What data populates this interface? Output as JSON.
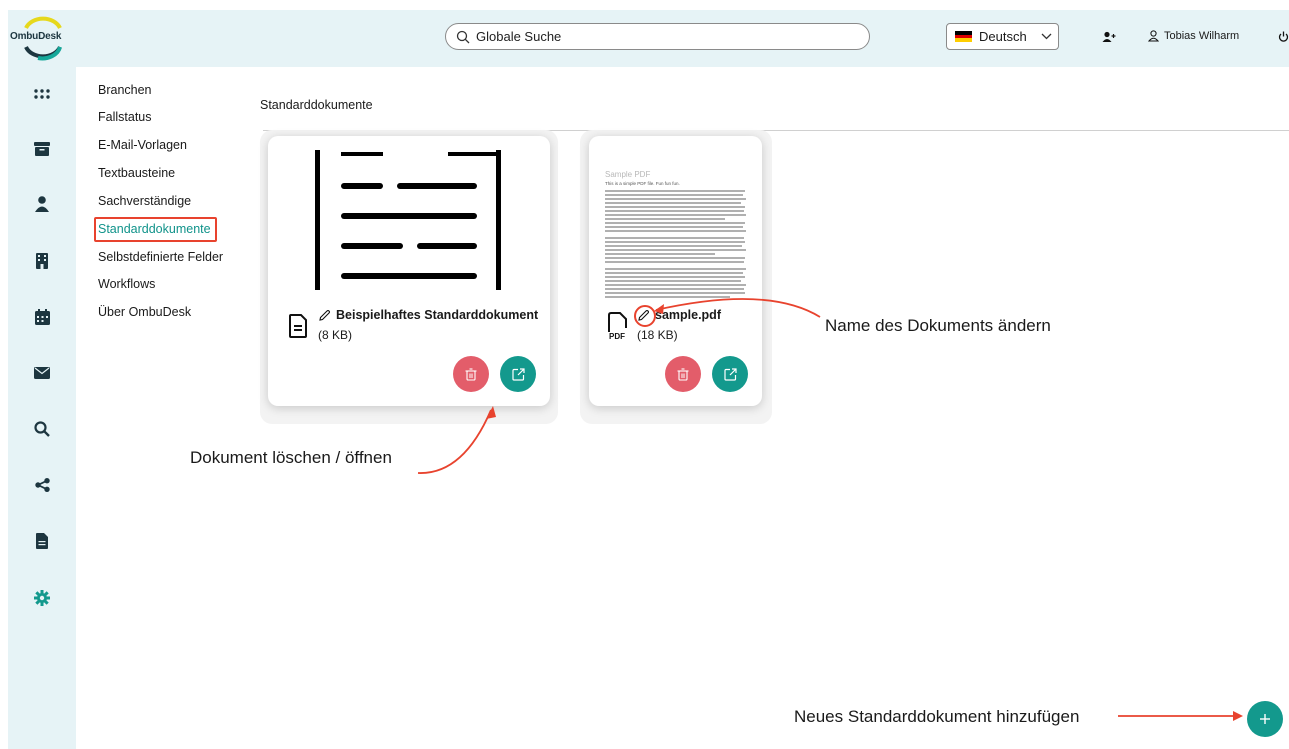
{
  "app": {
    "logo_text": "OmbuDesk"
  },
  "topbar": {
    "search_placeholder": "Globale Suche",
    "language": "Deutsch",
    "user_name": "Tobias Wilharm"
  },
  "rail": {
    "icons": [
      "apps-icon",
      "archive-icon",
      "person-icon",
      "building-icon",
      "calendar-icon",
      "mail-icon",
      "search-icon",
      "share-icon",
      "document-icon",
      "settings-icon"
    ]
  },
  "settings_menu": {
    "items": [
      "Branchen",
      "Fallstatus",
      "E-Mail-Vorlagen",
      "Textbausteine",
      "Sachverständige",
      "Standarddokumente",
      "Selbstdefinierte Felder",
      "Workflows",
      "Über OmbuDesk"
    ],
    "active_index": 5
  },
  "main": {
    "title": "Standarddokumente",
    "documents": [
      {
        "name": "Beispielhaftes Standarddokument",
        "size": "(8 KB)",
        "type": "doc"
      },
      {
        "name": "sample.pdf",
        "size": "(18 KB)",
        "type": "pdf"
      }
    ],
    "pdf_preview": {
      "title": "Sample PDF",
      "subtitle": "This is a simple PDF file. Fun fun fun."
    }
  },
  "annotations": {
    "rename": "Name des Dokuments ändern",
    "delete_open": "Dokument löschen / öffnen",
    "add_new": "Neues Standarddokument hinzufügen"
  },
  "colors": {
    "teal": "#13998d",
    "delete_red": "#e35d6a",
    "highlight_red": "#e8432e",
    "rail_bg": "#e6f3f6",
    "active_text": "#10938a"
  }
}
